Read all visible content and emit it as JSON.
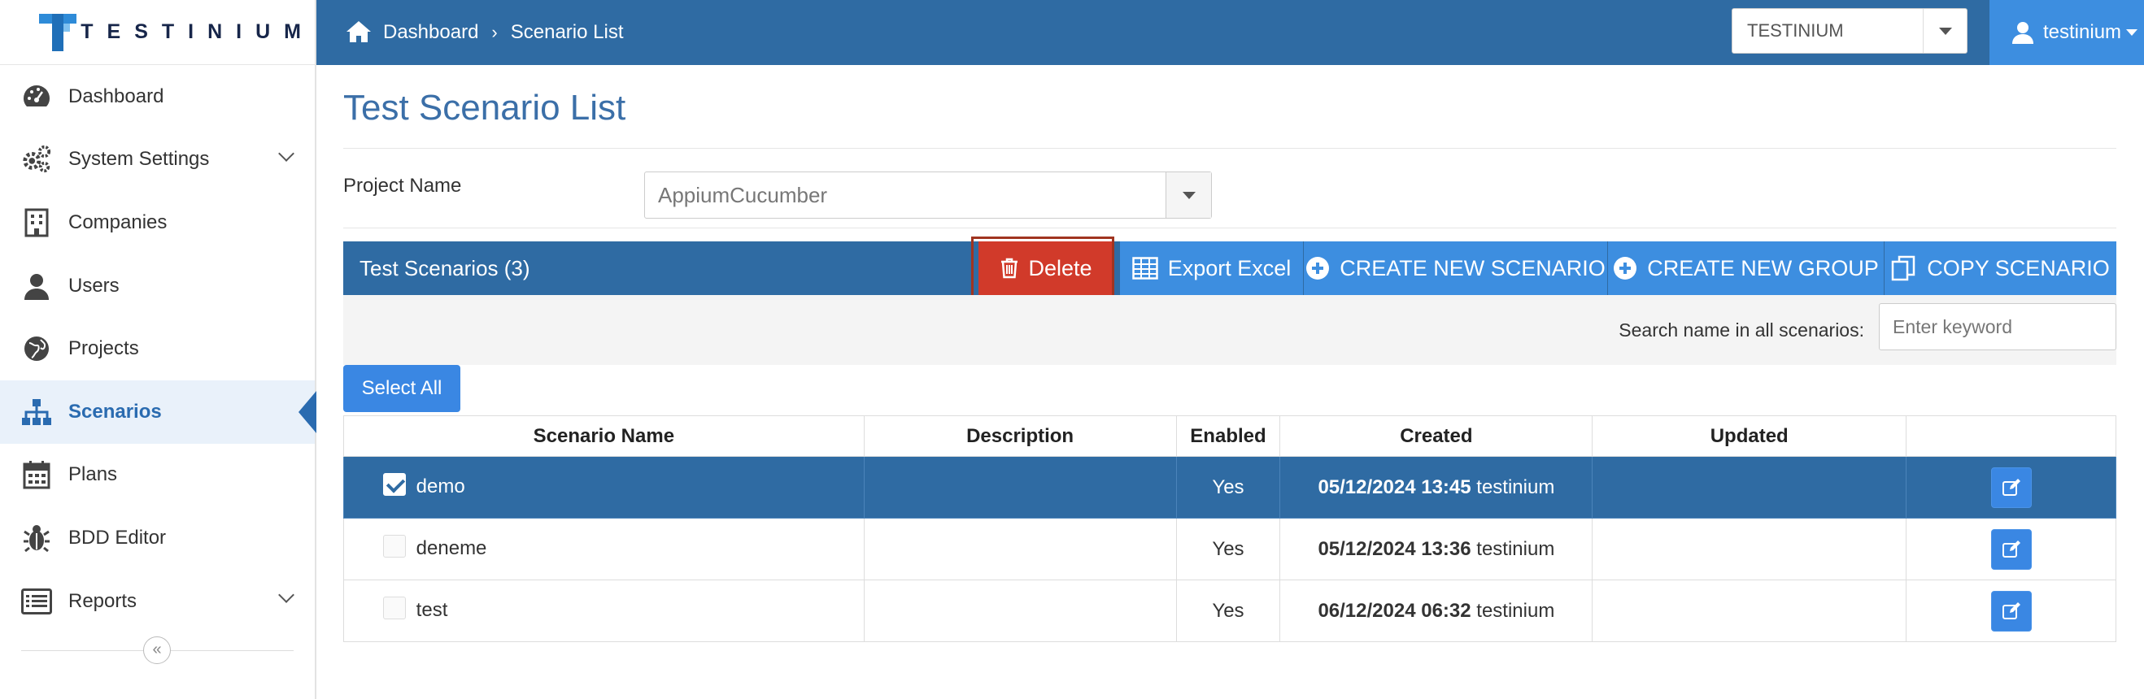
{
  "brand": {
    "name": "TESTINIUM"
  },
  "topbar": {
    "breadcrumb": [
      "Dashboard",
      "Scenario List"
    ],
    "org_select": "TESTINIUM",
    "user": "testinium"
  },
  "sidebar": {
    "items": [
      {
        "label": "Dashboard",
        "icon": "dashboard-icon"
      },
      {
        "label": "System Settings",
        "icon": "gears-icon",
        "expandable": true
      },
      {
        "label": "Companies",
        "icon": "building-icon"
      },
      {
        "label": "Users",
        "icon": "user-icon"
      },
      {
        "label": "Projects",
        "icon": "globe-icon"
      },
      {
        "label": "Scenarios",
        "icon": "sitemap-icon",
        "active": true
      },
      {
        "label": "Plans",
        "icon": "calendar-icon"
      },
      {
        "label": "BDD Editor",
        "icon": "bug-icon"
      },
      {
        "label": "Reports",
        "icon": "list-icon",
        "expandable": true
      }
    ],
    "collapse": "«"
  },
  "main": {
    "title": "Test Scenario List",
    "project_label": "Project Name",
    "project_value": "AppiumCucumber",
    "panel_title": "Test Scenarios (3)",
    "buttons": {
      "delete": "Delete",
      "export": "Export Excel",
      "create_scenario": "CREATE NEW SCENARIO",
      "create_group": "CREATE NEW GROUP",
      "copy": "COPY SCENARIO"
    },
    "search_label": "Search name in all scenarios:",
    "search_placeholder": "Enter keyword",
    "select_all": "Select All"
  },
  "table": {
    "headers": [
      "Scenario Name",
      "Description",
      "Enabled",
      "Created",
      "Updated",
      ""
    ],
    "rows": [
      {
        "name": "demo",
        "description": "",
        "enabled": "Yes",
        "created_date": "05/12/2024 13:45",
        "created_by": "testinium",
        "updated": "",
        "checked": true
      },
      {
        "name": "deneme",
        "description": "",
        "enabled": "Yes",
        "created_date": "05/12/2024 13:36",
        "created_by": "testinium",
        "updated": "",
        "checked": false
      },
      {
        "name": "test",
        "description": "",
        "enabled": "Yes",
        "created_date": "06/12/2024 06:32",
        "created_by": "testinium",
        "updated": "",
        "checked": false
      }
    ]
  },
  "colors": {
    "primary": "#2f6ba3",
    "accent": "#3d8ee0",
    "danger": "#d13a2a"
  }
}
